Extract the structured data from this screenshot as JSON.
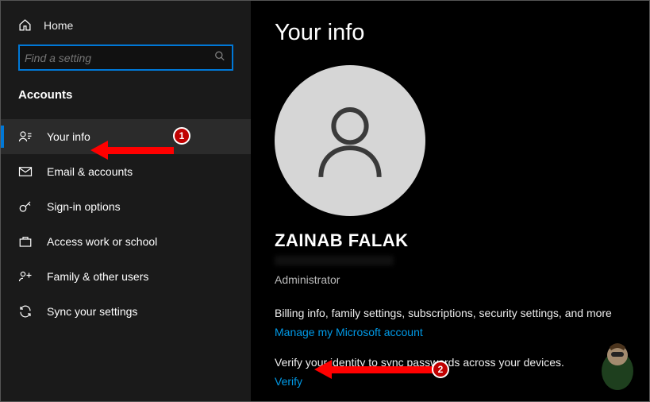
{
  "sidebar": {
    "home_label": "Home",
    "search_placeholder": "Find a setting",
    "section_title": "Accounts",
    "items": [
      {
        "label": "Your info"
      },
      {
        "label": "Email & accounts"
      },
      {
        "label": "Sign-in options"
      },
      {
        "label": "Access work or school"
      },
      {
        "label": "Family & other users"
      },
      {
        "label": "Sync your settings"
      }
    ]
  },
  "main": {
    "page_title": "Your info",
    "username": "ZAINAB FALAK",
    "role": "Administrator",
    "billing_desc": "Billing info, family settings, subscriptions, security settings, and more",
    "manage_link": "Manage my Microsoft account",
    "verify_desc": "Verify your identity to sync passwords across your devices.",
    "verify_link": "Verify"
  },
  "annotations": {
    "badge1": "1",
    "badge2": "2"
  }
}
